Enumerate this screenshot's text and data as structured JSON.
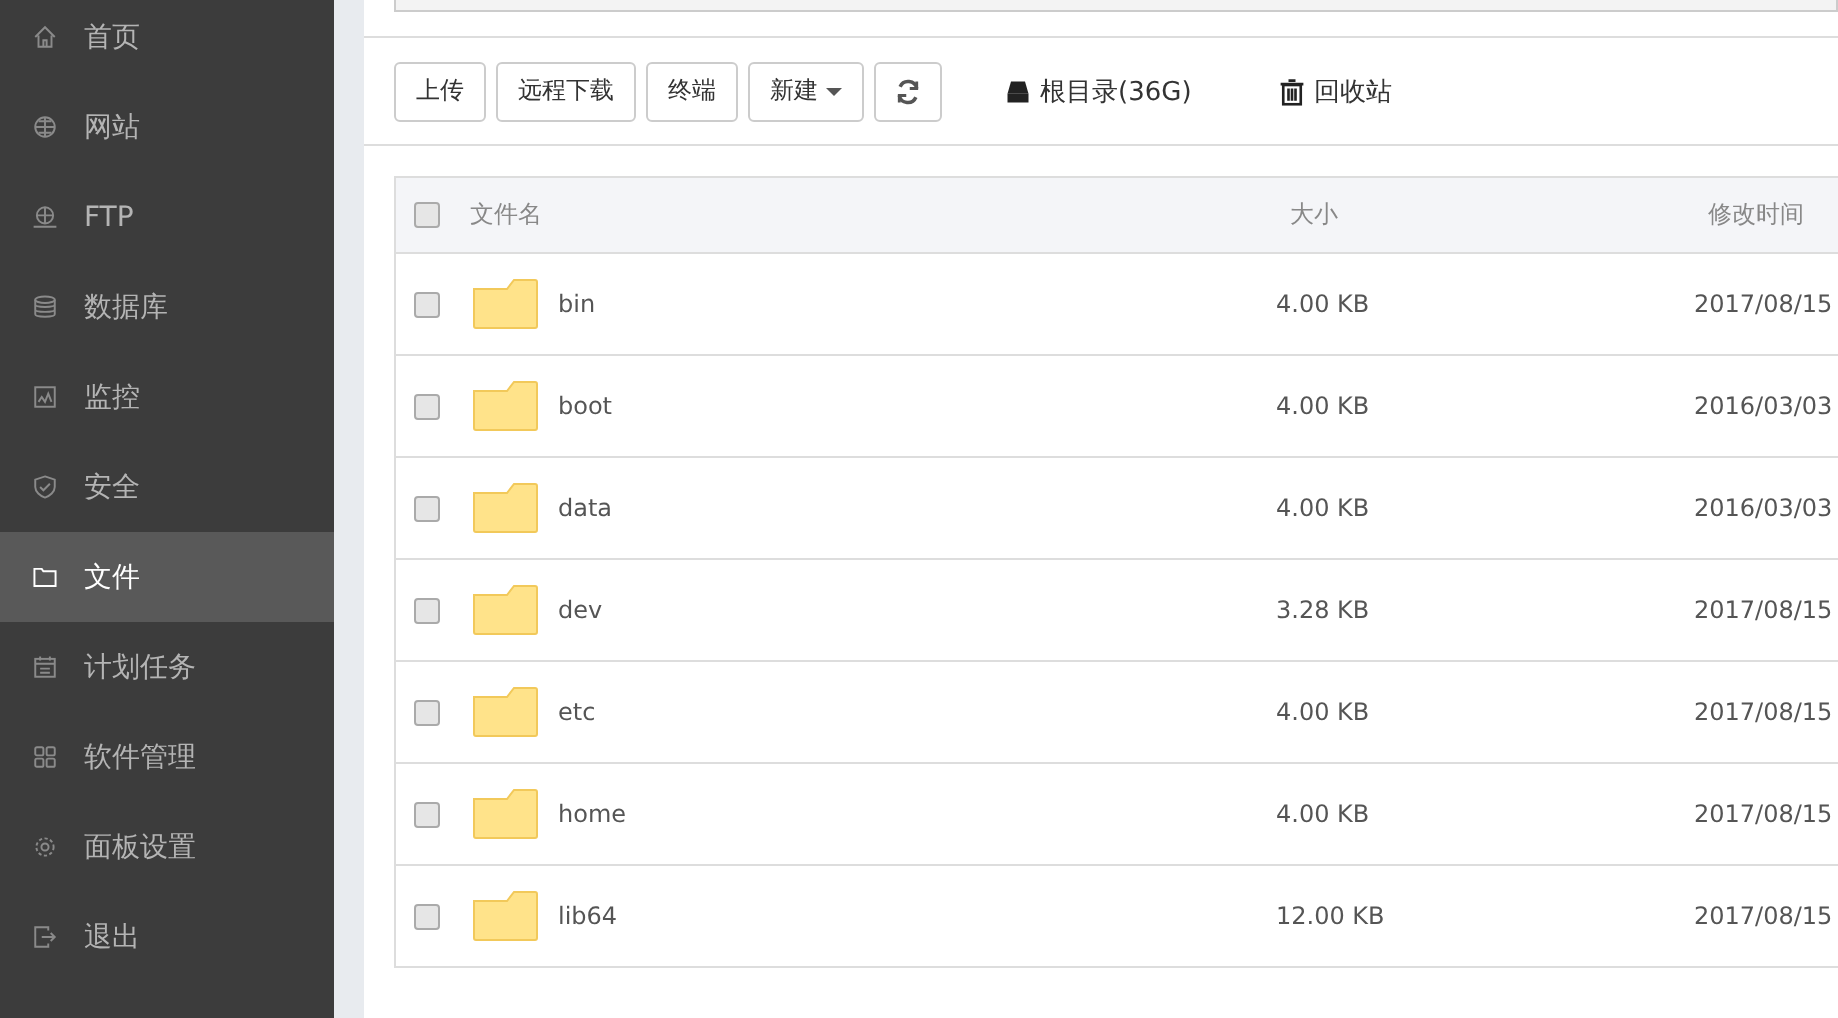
{
  "sidebar": {
    "items": [
      {
        "label": "首页",
        "selected": false
      },
      {
        "label": "网站",
        "selected": false
      },
      {
        "label": "FTP",
        "selected": false
      },
      {
        "label": "数据库",
        "selected": false
      },
      {
        "label": "监控",
        "selected": false
      },
      {
        "label": "安全",
        "selected": false
      },
      {
        "label": "文件",
        "selected": true
      },
      {
        "label": "计划任务",
        "selected": false
      },
      {
        "label": "软件管理",
        "selected": false
      },
      {
        "label": "面板设置",
        "selected": false
      },
      {
        "label": "退出",
        "selected": false
      }
    ]
  },
  "toolbar": {
    "buttons": [
      {
        "kind": "text",
        "label": "上传"
      },
      {
        "kind": "text",
        "label": "远程下载"
      },
      {
        "kind": "text",
        "label": "终端"
      },
      {
        "kind": "dropdown",
        "label": "新建"
      },
      {
        "kind": "refresh"
      }
    ],
    "links": [
      {
        "label": "根目录(36G)"
      },
      {
        "label": "回收站"
      }
    ]
  },
  "table": {
    "header_checked": false,
    "columns": [
      "文件名",
      "大小",
      "修改时间"
    ],
    "rows": [
      {
        "checked": false,
        "name": "bin",
        "size": "4.00 KB",
        "modified": "2017/08/15"
      },
      {
        "checked": false,
        "name": "boot",
        "size": "4.00 KB",
        "modified": "2016/03/03"
      },
      {
        "checked": false,
        "name": "data",
        "size": "4.00 KB",
        "modified": "2016/03/03"
      },
      {
        "checked": false,
        "name": "dev",
        "size": "3.28 KB",
        "modified": "2017/08/15"
      },
      {
        "checked": false,
        "name": "etc",
        "size": "4.00 KB",
        "modified": "2017/08/15"
      },
      {
        "checked": false,
        "name": "home",
        "size": "4.00 KB",
        "modified": "2017/08/15"
      },
      {
        "checked": false,
        "name": "lib64",
        "size": "12.00 KB",
        "modified": "2017/08/15"
      }
    ]
  }
}
